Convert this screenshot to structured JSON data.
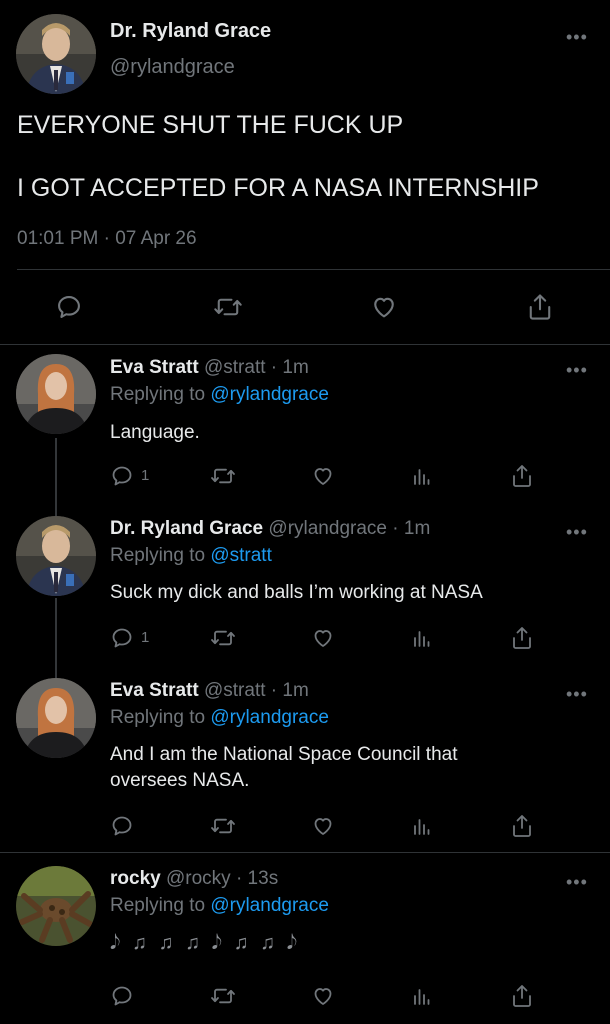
{
  "main_tweet": {
    "display_name": "Dr. Ryland Grace",
    "handle": "@rylandgrace",
    "line1": "EVERYONE SHUT THE FUCK UP",
    "line2": "I GOT ACCEPTED FOR A NASA INTERNSHIP",
    "timestamp": "01:01 PM · 07 Apr 26"
  },
  "replies": [
    {
      "display_name": "Eva Stratt",
      "handle": "@stratt",
      "time": "· 1m",
      "replying_prefix": "Replying to",
      "replying_to": "@rylandgrace",
      "text": "Language.",
      "reply_count": "1"
    },
    {
      "display_name": "Dr. Ryland Grace",
      "handle": "@rylandgrace",
      "time": "· 1m",
      "replying_prefix": "Replying to",
      "replying_to": "@stratt",
      "text": "Suck my dick and balls I’m working at NASA",
      "reply_count": "1"
    },
    {
      "display_name": "Eva Stratt",
      "handle": "@stratt",
      "time": "· 1m",
      "replying_prefix": "Replying to",
      "replying_to": "@rylandgrace",
      "text_line1": "And I am the National Space Council that",
      "text_line2": "oversees NASA."
    },
    {
      "display_name": "rocky",
      "handle": "@rocky",
      "time": "· 13s",
      "replying_prefix": "Replying to",
      "replying_to": "@rylandgrace",
      "text": "𝅘𝅥𝅮 ♫ ♫ ♫ 𝅘𝅥𝅮 ♫ ♫ 𝅘𝅥𝅮"
    }
  ],
  "colors": {
    "background": "#000000",
    "text": "#e7e9ea",
    "muted": "#71767b",
    "link": "#1d9bf0",
    "divider": "#2f3336"
  }
}
